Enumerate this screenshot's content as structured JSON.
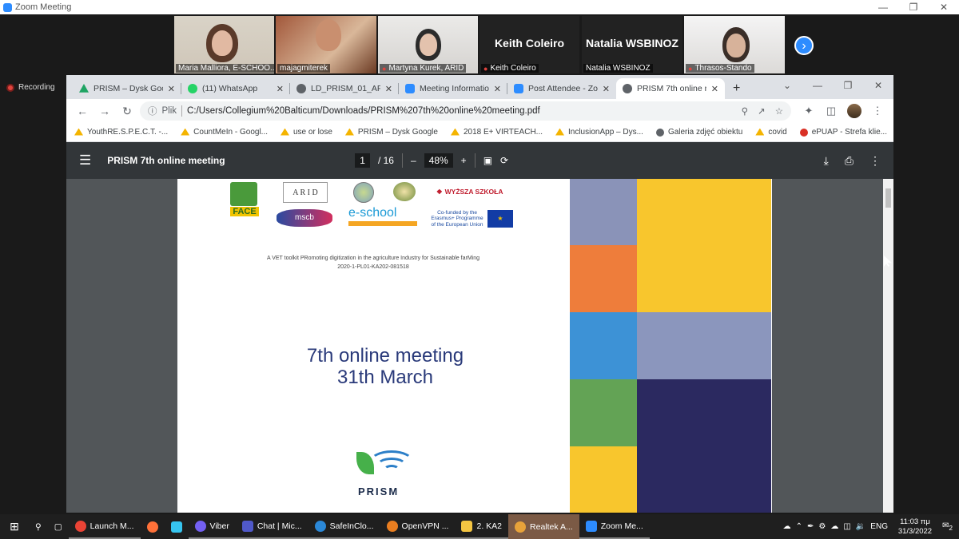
{
  "zoom": {
    "window_title": "Zoom Meeting",
    "recording_label": "Recording",
    "participants": [
      {
        "name": "Maria Malliora, E-SCHOO...",
        "video": true
      },
      {
        "name": "majagmiterek",
        "video": true
      },
      {
        "name": "Martyna Kurek, ARID",
        "video": true,
        "muted": true
      },
      {
        "name": "Keith Coleiro",
        "display": "Keith Coleiro",
        "video": false,
        "muted": true
      },
      {
        "name": "Natalia WSBINOZ",
        "display": "Natalia WSBINOZ",
        "video": false
      },
      {
        "name": "Thrasos-Stando",
        "video": true,
        "muted": true
      }
    ],
    "next_icon": "chevron-right-icon"
  },
  "browser": {
    "tabs": [
      {
        "label": "PRISM – Dysk Goo",
        "icon": "google-drive-icon",
        "color": "#1fa463"
      },
      {
        "label": "(11) WhatsApp",
        "icon": "whatsapp-icon",
        "color": "#25d366"
      },
      {
        "label": "LD_PRISM_01_APP",
        "icon": "globe-icon",
        "color": "#5f6368"
      },
      {
        "label": "Meeting Informatio",
        "icon": "zoom-icon",
        "color": "#2d8cff"
      },
      {
        "label": "Post Attendee - Zo",
        "icon": "zoom-icon",
        "color": "#2d8cff"
      },
      {
        "label": "PRISM 7th online m",
        "icon": "globe-icon",
        "color": "#5f6368",
        "active": true
      }
    ],
    "new_tab": "+",
    "address_prefix": "Plik",
    "address": "C:/Users/Collegium%20Balticum/Downloads/PRISM%207th%20online%20meeting.pdf",
    "bookmarks": [
      {
        "label": "YouthRE.S.P.E.C.T. -...",
        "color": "#f4b400"
      },
      {
        "label": "CountMeIn - Googl...",
        "color": "#f4b400"
      },
      {
        "label": "use or lose",
        "color": "#f4b400"
      },
      {
        "label": "PRISM – Dysk Google",
        "color": "#f4b400"
      },
      {
        "label": "2018 E+ VIRTEACH...",
        "color": "#f4b400"
      },
      {
        "label": "InclusionApp – Dys...",
        "color": "#f4b400"
      },
      {
        "label": "Galeria zdjęć obiektu",
        "color": "#5f6368"
      },
      {
        "label": "covid",
        "color": "#f4b400"
      },
      {
        "label": "ePUAP - Strefa klie...",
        "color": "#d93025"
      }
    ],
    "bookmarks_more": "»"
  },
  "pdf": {
    "title": "PRISM 7th online meeting",
    "page_current": "1",
    "page_total": "/ 16",
    "zoom": "48%",
    "zoom_out": "–",
    "zoom_in": "+",
    "content": {
      "arid_label": "A R I D",
      "face_label": "FACE",
      "mscb_label": "mscb",
      "eschool_label": "e-school",
      "wyzsza_label": "WYŻSZA SZKOŁA",
      "cofunded": "Co-funded by the Erasmus+ Programme of the European Union",
      "subtitle_line1": "A VET toolkit PRomoting digitization in the agriculture Industry for Sustainable farMing",
      "subtitle_line2": "2020-1-PL01-KA202-081518",
      "meeting_line1": "7th online meeting",
      "meeting_line2": "31th March",
      "prism_logo_text": "PRISM",
      "color_blocks": [
        "#8a93b8",
        "#ee7d3b",
        "#f8c62d",
        "#3d92d6",
        "#8b96bd",
        "#63a355",
        "#2b2960",
        "#f8c62d"
      ]
    }
  },
  "taskbar": {
    "items": [
      {
        "label": "Launch M...",
        "color": "#ea4335"
      },
      {
        "label": "",
        "color": "#ff7139"
      },
      {
        "label": "",
        "color": "#36c5f0"
      },
      {
        "label": "Viber",
        "color": "#7360f2"
      },
      {
        "label": "Chat | Mic...",
        "color": "#5059c9"
      },
      {
        "label": "SafeInClo...",
        "color": "#2b88d8"
      },
      {
        "label": "OpenVPN ...",
        "color": "#ea7e20"
      },
      {
        "label": "2. KA2",
        "color": "#f4c542"
      },
      {
        "label": "Realtek A...",
        "color": "#e8a33a"
      },
      {
        "label": "Zoom Me...",
        "color": "#2d8cff"
      }
    ],
    "language": "ENG",
    "time": "11:03 πμ",
    "date": "31/3/2022",
    "notifications": "2"
  }
}
